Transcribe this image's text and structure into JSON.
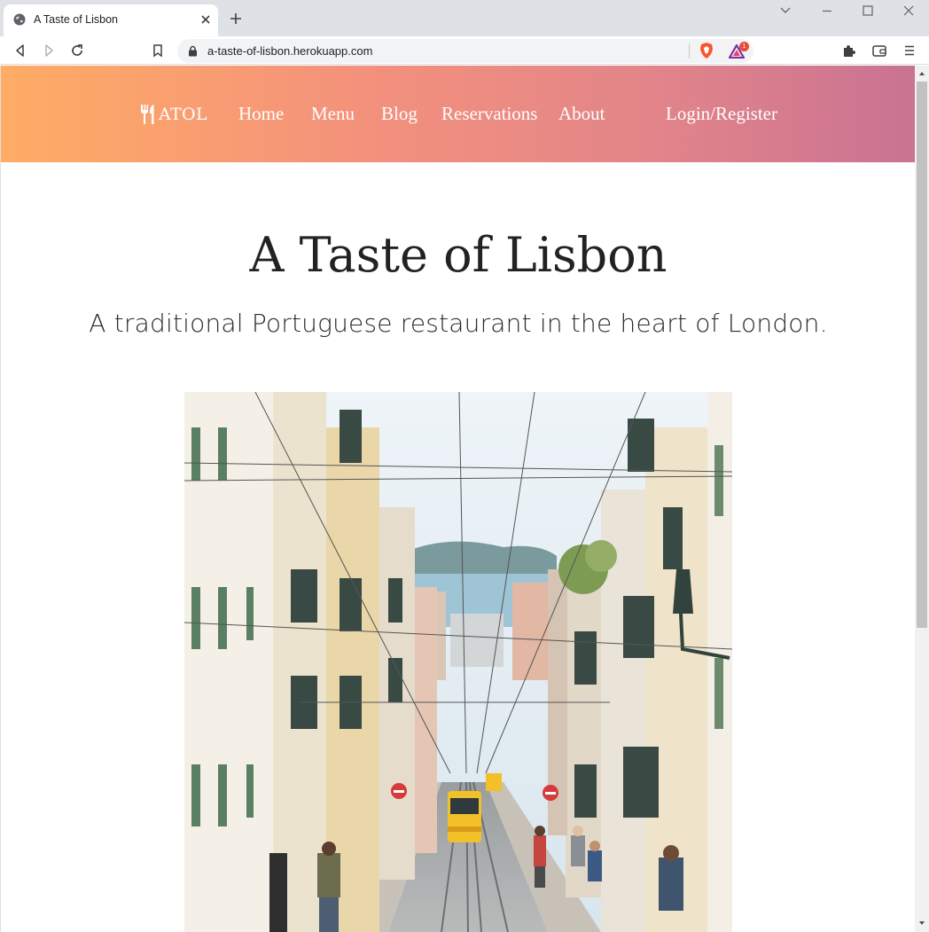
{
  "browser": {
    "tab_title": "A Taste of Lisbon",
    "url": "a-taste-of-lisbon.herokuapp.com",
    "brave_badge_count": "1"
  },
  "navbar": {
    "brand": "ATOL",
    "links": [
      "Home",
      "Menu",
      "Blog",
      "Reservations",
      "About"
    ],
    "auth": "Login/Register"
  },
  "hero": {
    "title": "A Taste of Lisbon",
    "subtitle": "A traditional Portuguese restaurant in the heart of London."
  },
  "colors": {
    "gradient_start": "#ffac65",
    "gradient_end": "#c97393",
    "tram_yellow": "#f2c029"
  }
}
